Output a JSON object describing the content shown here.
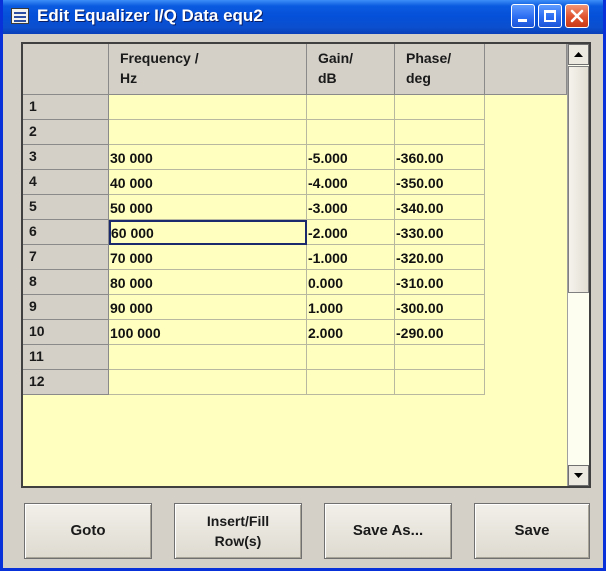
{
  "window": {
    "title": "Edit Equalizer I/Q Data equ2",
    "icon": "table-edit-icon",
    "controls": [
      "minimize-icon",
      "maximize-icon",
      "close-icon"
    ]
  },
  "table": {
    "headers": {
      "frequency": "Frequency /\nHz",
      "gain": "Gain/\ndB",
      "phase": "Phase/\ndeg"
    },
    "rows": [
      {
        "num": "1",
        "frequency": "",
        "gain": "",
        "phase": ""
      },
      {
        "num": "2",
        "frequency": "",
        "gain": "",
        "phase": ""
      },
      {
        "num": "3",
        "frequency": "30 000",
        "gain": "-5.000",
        "phase": "-360.00"
      },
      {
        "num": "4",
        "frequency": "40 000",
        "gain": "-4.000",
        "phase": "-350.00"
      },
      {
        "num": "5",
        "frequency": "50 000",
        "gain": "-3.000",
        "phase": "-340.00"
      },
      {
        "num": "6",
        "frequency": "60 000",
        "gain": "-2.000",
        "phase": "-330.00"
      },
      {
        "num": "7",
        "frequency": "70 000",
        "gain": "-1.000",
        "phase": "-320.00"
      },
      {
        "num": "8",
        "frequency": "80 000",
        "gain": "0.000",
        "phase": "-310.00"
      },
      {
        "num": "9",
        "frequency": "90 000",
        "gain": "1.000",
        "phase": "-300.00"
      },
      {
        "num": "10",
        "frequency": "100 000",
        "gain": "2.000",
        "phase": "-290.00"
      },
      {
        "num": "11",
        "frequency": "",
        "gain": "",
        "phase": ""
      },
      {
        "num": "12",
        "frequency": "",
        "gain": "",
        "phase": ""
      }
    ],
    "focused_row": "6"
  },
  "buttons": {
    "goto": "Goto",
    "insert_fill": "Insert/Fill\nRow(s)",
    "save_as": "Save As...",
    "save": "Save"
  },
  "colors": {
    "cell_background": "#ffffc0",
    "title_bar": "#0550d8",
    "header_background": "#d4d0c8"
  }
}
